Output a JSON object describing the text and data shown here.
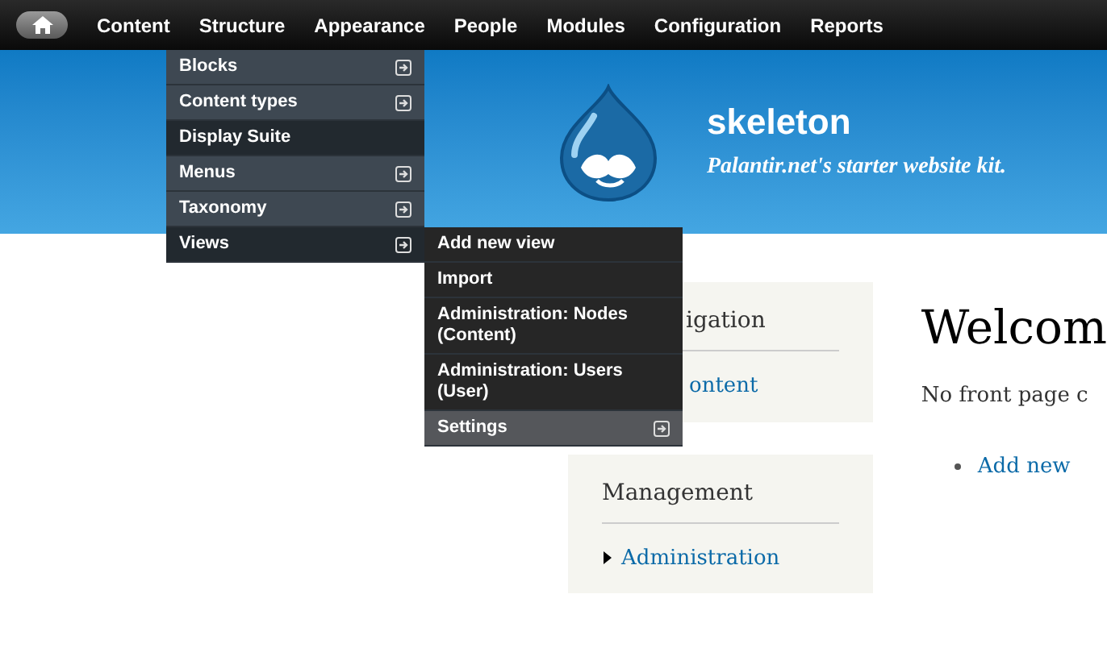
{
  "toolbar": {
    "items": [
      "Content",
      "Structure",
      "Appearance",
      "People",
      "Modules",
      "Configuration",
      "Reports"
    ]
  },
  "structure_menu": {
    "items": [
      {
        "label": "Blocks",
        "highlighted": false,
        "has_submenu": true
      },
      {
        "label": "Content types",
        "highlighted": false,
        "has_submenu": true
      },
      {
        "label": "Display Suite",
        "highlighted": true,
        "has_submenu": false
      },
      {
        "label": "Menus",
        "highlighted": false,
        "has_submenu": true
      },
      {
        "label": "Taxonomy",
        "highlighted": false,
        "has_submenu": true
      },
      {
        "label": "Views",
        "highlighted": true,
        "has_submenu": true
      }
    ]
  },
  "views_menu": {
    "items": [
      {
        "label": "Add new view",
        "highlighted": false,
        "has_submenu": false
      },
      {
        "label": "Import",
        "highlighted": false,
        "has_submenu": false
      },
      {
        "label": "Administration: Nodes (Content)",
        "highlighted": false,
        "has_submenu": false
      },
      {
        "label": "Administration: Users (User)",
        "highlighted": false,
        "has_submenu": false
      },
      {
        "label": "Settings",
        "highlighted": true,
        "has_submenu": true
      }
    ]
  },
  "header": {
    "site_name": "skeleton",
    "slogan": "Palantir.net's starter website kit."
  },
  "sidebar": {
    "blocks": [
      {
        "title": "igation",
        "links": [
          {
            "text": "ontent",
            "kind": "plain"
          }
        ]
      },
      {
        "title": "Management",
        "links": [
          {
            "text": "Administration",
            "kind": "triangle"
          }
        ]
      }
    ]
  },
  "content": {
    "title": "Welcom",
    "text": "No front page c",
    "links": [
      "Add new"
    ]
  }
}
